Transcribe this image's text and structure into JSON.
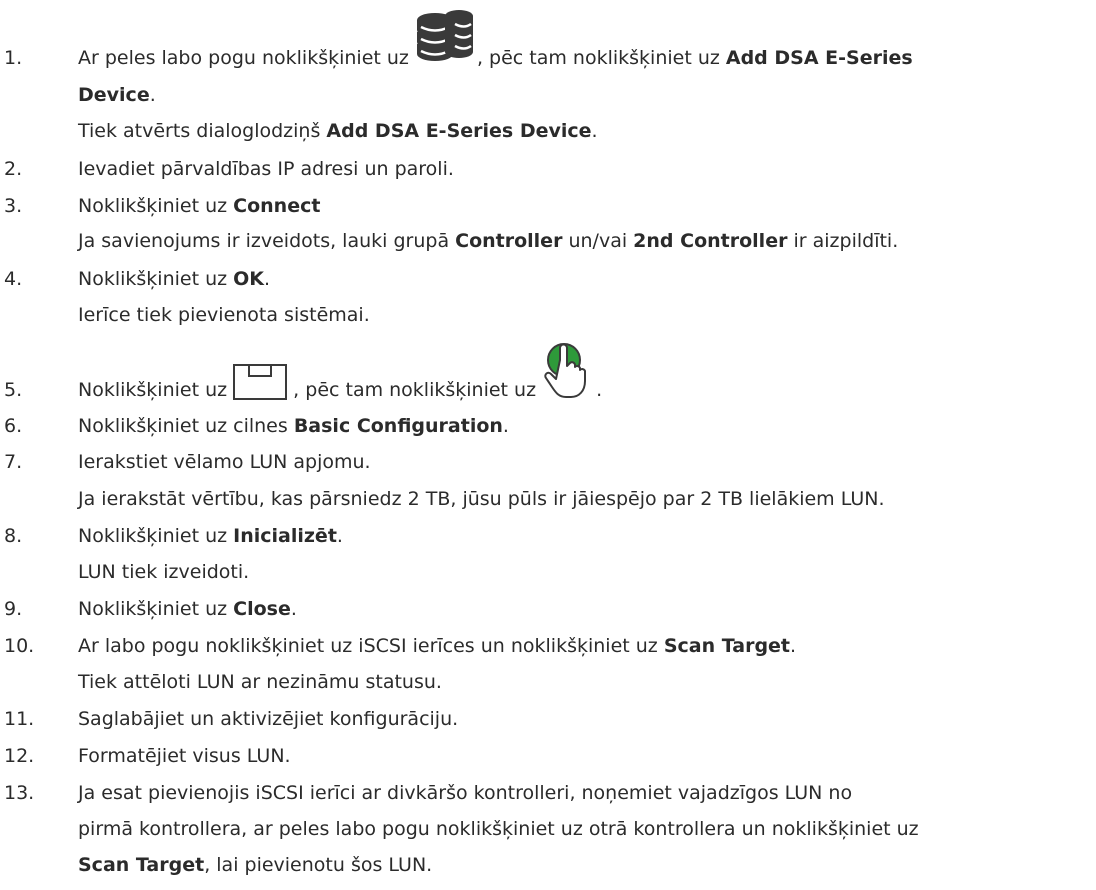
{
  "steps": [
    {
      "num": "1.",
      "lines": [
        [
          {
            "t": "Ar peles labo pogu noklikšķiniet uz "
          },
          {
            "icon": "database-stack-icon"
          },
          {
            "t": ", pēc tam noklikšķiniet uz "
          },
          {
            "t": "Add DSA E-Series",
            "b": true
          }
        ],
        [
          {
            "t": "Device",
            "b": true
          },
          {
            "t": "."
          }
        ],
        [
          {
            "t": "Tiek atvērts dialoglodziņš "
          },
          {
            "t": "Add DSA E-Series Device",
            "b": true
          },
          {
            "t": "."
          }
        ]
      ]
    },
    {
      "num": "2.",
      "lines": [
        [
          {
            "t": "Ievadiet pārvaldības IP adresi un paroli."
          }
        ]
      ]
    },
    {
      "num": "3.",
      "lines": [
        [
          {
            "t": "Noklikšķiniet uz "
          },
          {
            "t": "Connect",
            "b": true
          }
        ],
        [
          {
            "t": "Ja savienojums ir izveidots, lauki grupā "
          },
          {
            "t": "Controller",
            "b": true
          },
          {
            "t": " un/vai "
          },
          {
            "t": "2nd Controller",
            "b": true
          },
          {
            "t": " ir aizpildīti."
          }
        ]
      ]
    },
    {
      "num": "4.",
      "lines": [
        [
          {
            "t": "Noklikšķiniet uz "
          },
          {
            "t": "OK",
            "b": true
          },
          {
            "t": "."
          }
        ],
        [
          {
            "t": "Ierīce tiek pievienota sistēmai."
          }
        ]
      ]
    },
    {
      "num": "5.",
      "lines": [
        [
          {
            "t": "Noklikšķiniet uz "
          },
          {
            "icon": "storage-device-icon"
          },
          {
            "t": " , pēc tam noklikšķiniet uz "
          },
          {
            "icon": "green-hand-pointer-icon"
          },
          {
            "t": " ."
          }
        ]
      ]
    },
    {
      "num": "6.",
      "lines": [
        [
          {
            "t": "Noklikšķiniet uz cilnes "
          },
          {
            "t": "Basic Configuration",
            "b": true
          },
          {
            "t": "."
          }
        ]
      ]
    },
    {
      "num": "7.",
      "lines": [
        [
          {
            "t": "Ierakstiet vēlamo LUN apjomu."
          }
        ],
        [
          {
            "t": "Ja ierakstāt vērtību, kas pārsniedz 2 TB, jūsu pūls ir jāiespējo par 2 TB lielākiem LUN."
          }
        ]
      ]
    },
    {
      "num": "8.",
      "lines": [
        [
          {
            "t": "Noklikšķiniet uz "
          },
          {
            "t": "Inicializēt",
            "b": true
          },
          {
            "t": "."
          }
        ],
        [
          {
            "t": "LUN tiek izveidoti."
          }
        ]
      ]
    },
    {
      "num": "9.",
      "lines": [
        [
          {
            "t": "Noklikšķiniet uz "
          },
          {
            "t": "Close",
            "b": true
          },
          {
            "t": "."
          }
        ]
      ]
    },
    {
      "num": "10.",
      "lines": [
        [
          {
            "t": "Ar labo pogu noklikšķiniet uz iSCSI ierīces un noklikšķiniet uz "
          },
          {
            "t": "Scan Target",
            "b": true
          },
          {
            "t": "."
          }
        ],
        [
          {
            "t": "Tiek attēloti LUN ar nezināmu statusu."
          }
        ]
      ]
    },
    {
      "num": "11.",
      "lines": [
        [
          {
            "t": "Saglabājiet un aktivizējiet konfigurāciju."
          }
        ]
      ]
    },
    {
      "num": "12.",
      "lines": [
        [
          {
            "t": "Formatējiet visus LUN."
          }
        ]
      ]
    },
    {
      "num": "13.",
      "lines": [
        [
          {
            "t": "Ja esat pievienojis iSCSI ierīci ar divkāršo kontrolleri, noņemiet vajadzīgos LUN no"
          }
        ],
        [
          {
            "t": "pirmā kontrollera, ar peles labo pogu noklikšķiniet uz otrā kontrollera un noklikšķiniet uz"
          }
        ],
        [
          {
            "t": "Scan Target",
            "b": true
          },
          {
            "t": ", lai pievienotu šos LUN."
          }
        ]
      ]
    }
  ]
}
